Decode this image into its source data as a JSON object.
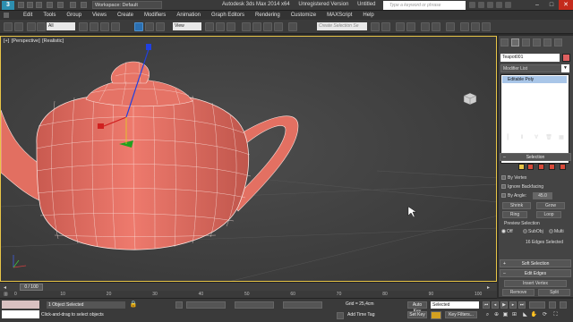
{
  "titlebar": {
    "logo": "3",
    "workspace": "Workspace: Default",
    "app_title": "Autodesk 3ds Max  2014 x64",
    "license": "Unregistered Version",
    "document": "Untitled",
    "search_placeholder": "Type a keyword or phrase"
  },
  "menus": [
    "Edit",
    "Tools",
    "Group",
    "Views",
    "Create",
    "Modifiers",
    "Animation",
    "Graph Editors",
    "Rendering",
    "Customize",
    "MAXScript",
    "Help"
  ],
  "toolbar": {
    "selection_filter": "All",
    "reference_coord": "View",
    "selection_set_placeholder": "Create Selection Se"
  },
  "viewport": {
    "labels": [
      "[+]",
      "[Perspective]",
      "[Realistic]"
    ],
    "object_color": "#e06a5e"
  },
  "command_panel": {
    "object_name": "Teapot001",
    "modifier_list": "Modifier List",
    "stack_item": "Editable Poly",
    "selection_rollout": {
      "title": "Selection",
      "by_vertex": "By Vertex",
      "ignore_backfacing": "Ignore Backfacing",
      "by_angle": "By Angle:",
      "by_angle_value": "45.0",
      "shrink": "Shrink",
      "grow": "Grow",
      "ring": "Ring",
      "loop": "Loop",
      "preview_selection": "Preview Selection",
      "preview_off": "Off",
      "preview_subobj": "SubObj",
      "preview_multi": "Multi",
      "selected_count": "16 Edges Selected"
    },
    "soft_selection": "Soft Selection",
    "edit_edges": "Edit Edges",
    "insert_vertex": "Insert Vertex",
    "remove": "Remove",
    "split": "Split"
  },
  "timeline": {
    "frame_counter": "0 / 100",
    "ticks": [
      "0",
      "10",
      "20",
      "30",
      "40",
      "50",
      "60",
      "70",
      "80",
      "90",
      "100"
    ]
  },
  "status": {
    "selection_msg": "1 Object Selected",
    "prompt": "Click-and-drag to select objects",
    "grid": "Grid = 25,4cm",
    "add_time_tag": "Add Time Tag",
    "auto_key": "Auto Key",
    "set_key": "Set Key",
    "selected": "Selected",
    "key_filters": "Key Filters..."
  }
}
